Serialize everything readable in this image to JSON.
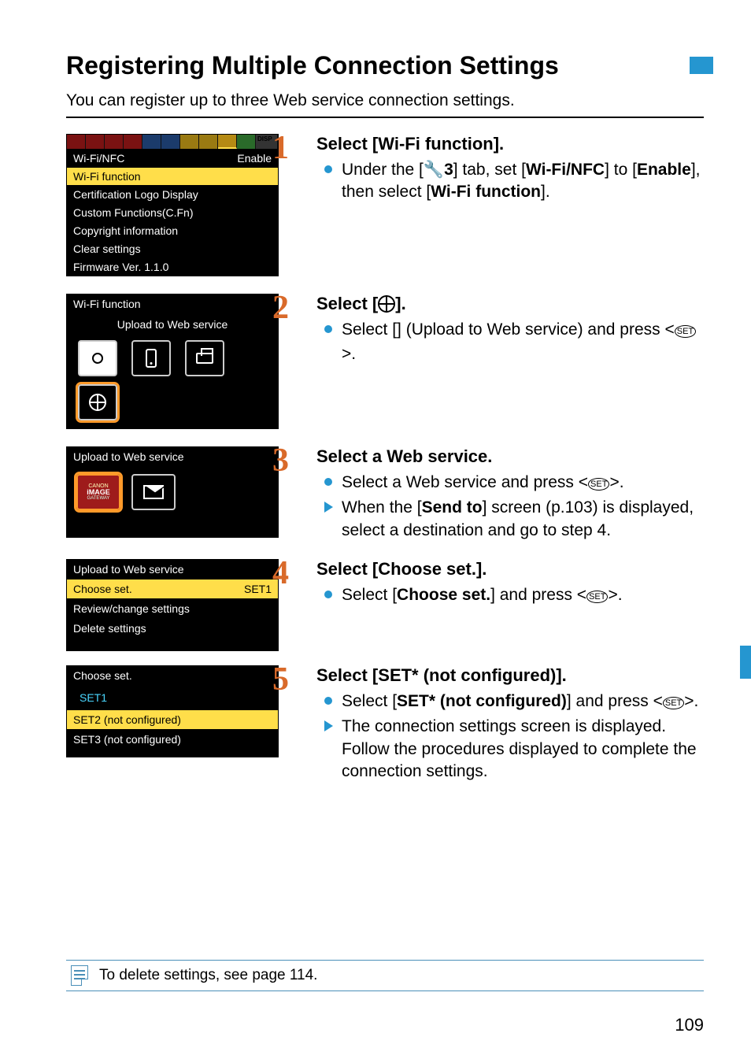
{
  "page": {
    "title": "Registering Multiple Connection Settings",
    "intro": "You can register up to three Web service connection settings.",
    "number": "109"
  },
  "steps": [
    {
      "num": "1",
      "heading_pre": "Select [",
      "heading_bold": "Wi-Fi function",
      "heading_post": "].",
      "b1_pre": "Under the [",
      "b1_m1": "3",
      "b1_mid": "] tab, set [",
      "b1_b1": "Wi-Fi/NFC",
      "b1_mid2": "] to [",
      "b1_b2": "Enable",
      "b1_mid3": "], then select [",
      "b1_b3": "Wi-Fi function",
      "b1_post": "]."
    },
    {
      "num": "2",
      "heading_pre": "Select [",
      "heading_post": "].",
      "b1_pre": "Select [",
      "b1_mid": "] (Upload to Web service) and press <",
      "b1_set": "SET",
      "b1_post": ">."
    },
    {
      "num": "3",
      "heading": "Select a Web service.",
      "b1_pre": "Select a Web service and press <",
      "b1_set": "SET",
      "b1_post": ">.",
      "b2_pre": "When the [",
      "b2_b": "Send to",
      "b2_post": "] screen (p.103) is displayed, select a destination and go to step 4."
    },
    {
      "num": "4",
      "heading_pre": "Select [",
      "heading_bold": "Choose set.",
      "heading_post": "].",
      "b1_pre": "Select [",
      "b1_b": "Choose set.",
      "b1_mid": "] and press <",
      "b1_set": "SET",
      "b1_post": ">."
    },
    {
      "num": "5",
      "heading_pre": "Select [",
      "heading_bold": "SET* (not configured)",
      "heading_post": "].",
      "b1_pre": "Select [",
      "b1_b": "SET* (not configured)",
      "b1_mid": "] and press <",
      "b1_set": "SET",
      "b1_post": ">.",
      "b2": "The connection settings screen is displayed. Follow the procedures displayed to complete the connection settings."
    }
  ],
  "shot1": {
    "disp": "DISP",
    "r0l": "Wi-Fi/NFC",
    "r0v": "Enable",
    "r1": "Wi-Fi function",
    "r2": "Certification Logo Display",
    "r3": "Custom Functions(C.Fn)",
    "r4": "Copyright information",
    "r5": "Clear settings",
    "r6": "Firmware Ver. 1.1.0"
  },
  "shot2": {
    "title": "Wi-Fi function",
    "sub": "Upload to Web service"
  },
  "shot3": {
    "title": "Upload to Web service",
    "cig1": "CANON",
    "cig2": "iMAGE",
    "cig3": "GATEWAY"
  },
  "shot4": {
    "title": "Upload to Web service",
    "r0l": "Choose set.",
    "r0v": "SET1",
    "r1": "Review/change settings",
    "r2": "Delete settings"
  },
  "shot5": {
    "title": "Choose set.",
    "r0": "SET1",
    "r1": "SET2 (not configured)",
    "r2": "SET3 (not configured)"
  },
  "footer": {
    "text": "To delete settings, see page 114."
  }
}
